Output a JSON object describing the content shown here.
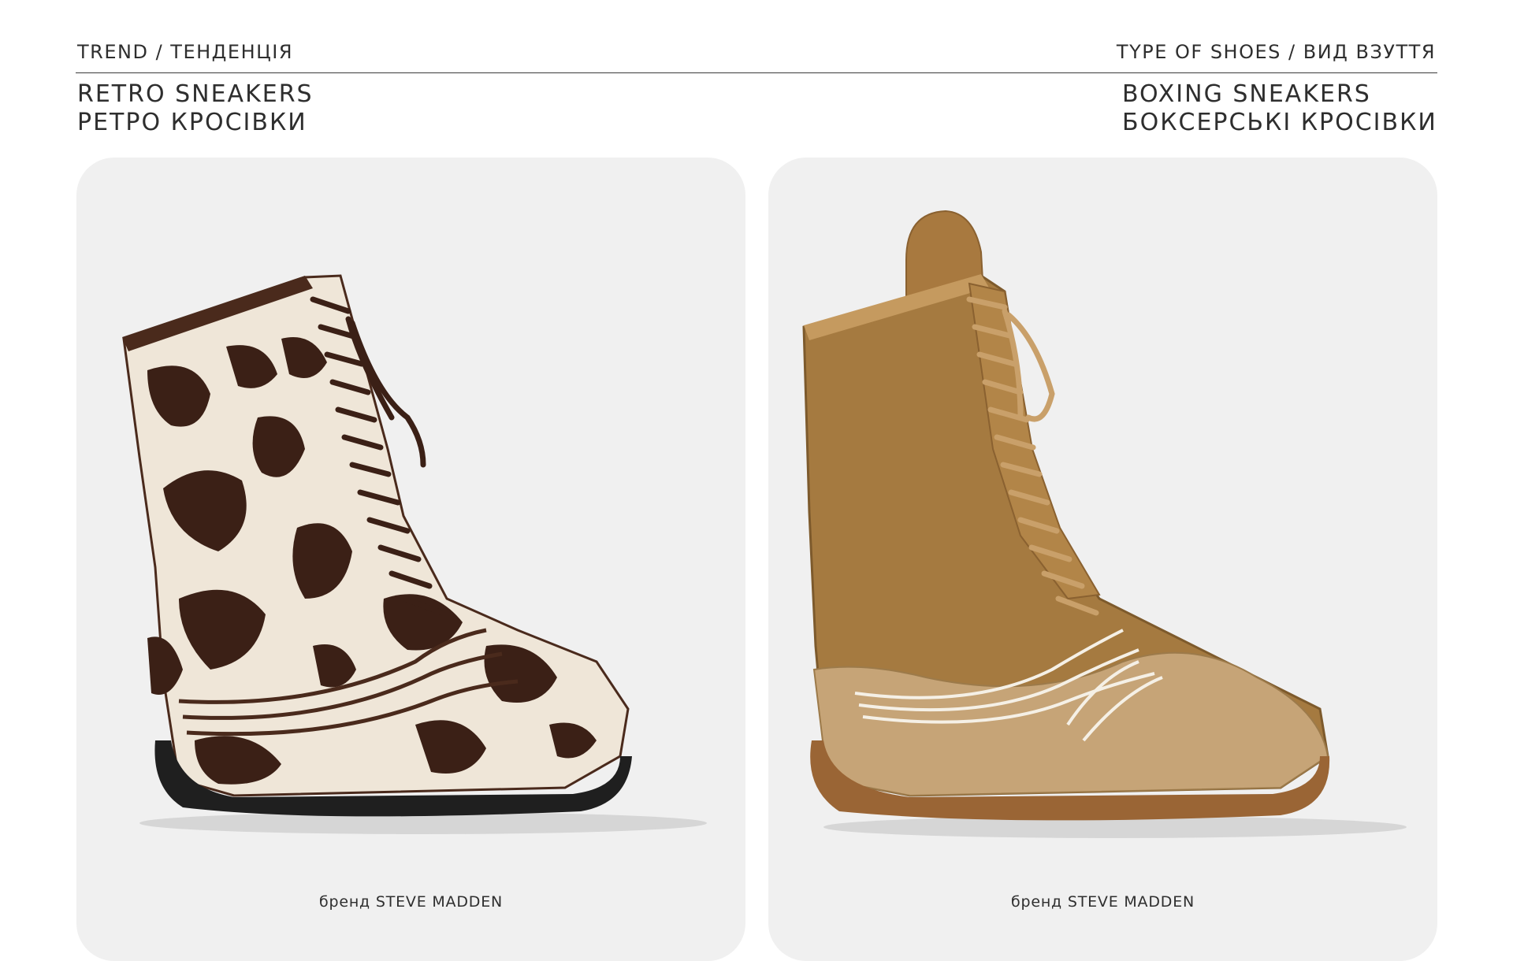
{
  "header": {
    "left": "TREND / ТЕНДЕНЦІЯ",
    "right": "TYPE OF SHOES / ВИД ВЗУТТЯ"
  },
  "trend": {
    "en": "RETRO SNEAKERS",
    "ua": "РЕТРО КРОСІВКИ"
  },
  "shoe_type": {
    "en": "BOXING SNEAKERS",
    "ua": "БОКСЕРСЬКІ КРОСІВКИ"
  },
  "products": [
    {
      "caption": "бренд STEVE MADDEN",
      "image": "cow-print boxing sneaker boot"
    },
    {
      "caption": "бренд STEVE MADDEN",
      "image": "tan suede boxing sneaker boot"
    }
  ],
  "colors": {
    "card_bg": "#f0f0f0",
    "text": "#2e2e2e"
  }
}
